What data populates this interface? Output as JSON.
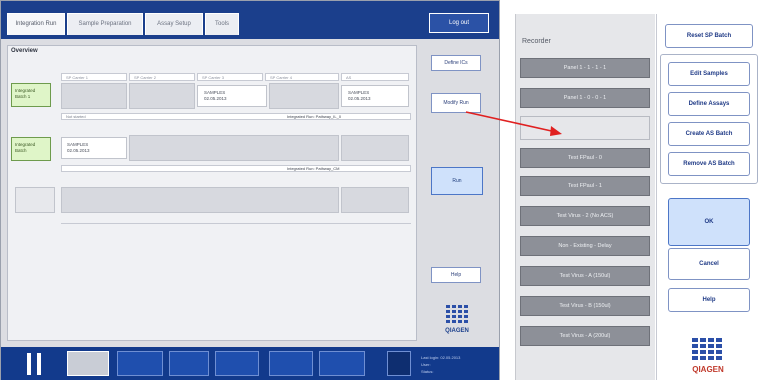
{
  "tabs": [
    {
      "label": "Integration Run"
    },
    {
      "label": "Sample Preparation"
    },
    {
      "label": "Assay Setup"
    },
    {
      "label": "Tools"
    }
  ],
  "logout_label": "Log out",
  "overview_title": "Overview",
  "column_headers": [
    "SP Carrier 1",
    "SP Carrier 2",
    "SP Carrier 3",
    "SP Carrier 4",
    "AS"
  ],
  "batches": [
    {
      "label": "Integrated Batch 1"
    },
    {
      "label": "Integrated Batch"
    }
  ],
  "cells": {
    "row1_cell3": "SAMPLES\n02.05.2013",
    "row1_cell5": "SAMPLES\n02.05.2013",
    "row2_cell1": "SAMPLES\n02.05.2013"
  },
  "info_bars": [
    {
      "left": "Not started",
      "right": "Integrated Run: Pathway_IL_0"
    },
    {
      "left": "",
      "right": "Integrated Run: Pathway_CM"
    }
  ],
  "side_buttons": {
    "define_ics": "Define ICs",
    "modify_run": "Modify Run",
    "run": "Run",
    "help": "Help"
  },
  "brand": "QIAGEN",
  "bottombar": {
    "status_lines": [
      "Last login: 02.05.2013",
      "User:",
      "Status:"
    ]
  },
  "popup": {
    "title": "Recorder",
    "options": [
      "Panel 1 - 1 - 1 - 1",
      "Panel 1 - 0 - 0 - 1",
      "",
      "Test FPaul - 0",
      "Test FPaul - 1",
      "Test Virus - 2 (No ACS)",
      "Non - Existing - Delay",
      "Test Virus - A (150ul)",
      "Test Virus - B (150ul)",
      "Test Virus - A (200ul)"
    ]
  },
  "right_panel": {
    "reset_sp_batch": "Reset SP Batch",
    "edit_samples": "Edit Samples",
    "define_assays": "Define Assays",
    "create_as_batch": "Create AS Batch",
    "remove_as_batch": "Remove AS Batch",
    "ok": "OK",
    "cancel": "Cancel",
    "help": "Help"
  },
  "colors": {
    "header_blue": "#1b3f8c",
    "batch_green": "#dff5c8",
    "run_blue": "#cfe1fb",
    "option_gray": "#8d9098",
    "arrow_red": "#e02020"
  }
}
